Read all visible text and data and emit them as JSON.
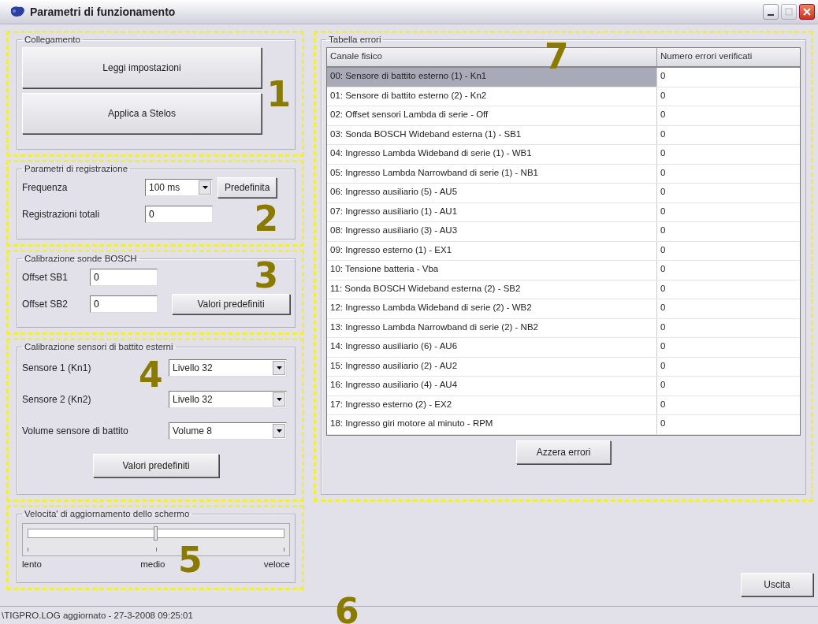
{
  "window": {
    "title": "Parametri di funzionamento"
  },
  "collegamento": {
    "marker": "1",
    "title": "Collegamento",
    "buttons": [
      "Leggi impostazioni",
      "Applica a Stelos"
    ]
  },
  "registrazione": {
    "marker": "2",
    "title": "Parametri di registrazione",
    "frequency": {
      "label": "Frequenza",
      "value": "100 ms"
    },
    "default_button": "Predefinita",
    "total": {
      "label": "Registrazioni totali",
      "value": "0"
    }
  },
  "bosch": {
    "marker": "3",
    "title": "Calibrazione sonde BOSCH",
    "fields": [
      {
        "label": "Offset SB1",
        "value": "0"
      },
      {
        "label": "Offset SB2",
        "value": "0"
      }
    ],
    "default_button": "Valori predefiniti"
  },
  "knock": {
    "marker": "4",
    "title": "Calibrazione sensori di battito esterni",
    "selects": [
      {
        "label": "Sensore 1 (Kn1)",
        "value": "Livello 32"
      },
      {
        "label": "Sensore 2 (Kn2)",
        "value": "Livello 32"
      },
      {
        "label": "Volume sensore di battito",
        "value": "Volume 8"
      }
    ],
    "default_button": "Valori predefiniti"
  },
  "refresh": {
    "marker": "5",
    "title": "Velocita' di aggiornamento dello schermo",
    "slider": {
      "level": 0.5
    },
    "scale_labels": [
      "lento",
      "medio",
      "veloce"
    ]
  },
  "errors": {
    "marker": "7",
    "title": "Tabella errori",
    "columns": [
      "Canale fisico",
      "Numero errori verificati"
    ],
    "rows": [
      {
        "channel": "00: Sensore di battito esterno (1) - Kn1",
        "count": "0",
        "selected": true
      },
      {
        "channel": "01: Sensore di battito esterno (2) - Kn2",
        "count": "0",
        "selected": false
      },
      {
        "channel": "02: Offset sensori Lambda di serie - Off",
        "count": "0",
        "selected": false
      },
      {
        "channel": "03: Sonda BOSCH Wideband esterna (1) - SB1",
        "count": "0",
        "selected": false
      },
      {
        "channel": "04: Ingresso Lambda Wideband di serie (1) - WB1",
        "count": "0",
        "selected": false
      },
      {
        "channel": "05: Ingresso Lambda Narrowband di serie (1) - NB1",
        "count": "0",
        "selected": false
      },
      {
        "channel": "06: Ingresso ausiliario (5) - AU5",
        "count": "0",
        "selected": false
      },
      {
        "channel": "07: Ingresso ausiliario (1) - AU1",
        "count": "0",
        "selected": false
      },
      {
        "channel": "08: Ingresso ausiliario (3) - AU3",
        "count": "0",
        "selected": false
      },
      {
        "channel": "09: Ingresso esterno (1) - EX1",
        "count": "0",
        "selected": false
      },
      {
        "channel": "10: Tensione batteria - Vba",
        "count": "0",
        "selected": false
      },
      {
        "channel": "11: Sonda BOSCH Wideband esterna (2) - SB2",
        "count": "0",
        "selected": false
      },
      {
        "channel": "12: Ingresso Lambda Wideband di serie (2) - WB2",
        "count": "0",
        "selected": false
      },
      {
        "channel": "13: Ingresso Lambda Narrowband di serie (2) - NB2",
        "count": "0",
        "selected": false
      },
      {
        "channel": "14: Ingresso ausiliario (6) - AU6",
        "count": "0",
        "selected": false
      },
      {
        "channel": "15: Ingresso ausiliario (2) - AU2",
        "count": "0",
        "selected": false
      },
      {
        "channel": "16: Ingresso ausiliario (4) - AU4",
        "count": "0",
        "selected": false
      },
      {
        "channel": "17: Ingresso esterno (2) - EX2",
        "count": "0",
        "selected": false
      },
      {
        "channel": "18: Ingresso giri motore al minuto - RPM",
        "count": "0",
        "selected": false
      }
    ],
    "reset_button": "Azzera errori"
  },
  "exit_button": "Uscita",
  "status_bar": {
    "marker": "6",
    "text": "\\TIGPRO.LOG aggiornato - 27-3-2008 09:25:01"
  }
}
